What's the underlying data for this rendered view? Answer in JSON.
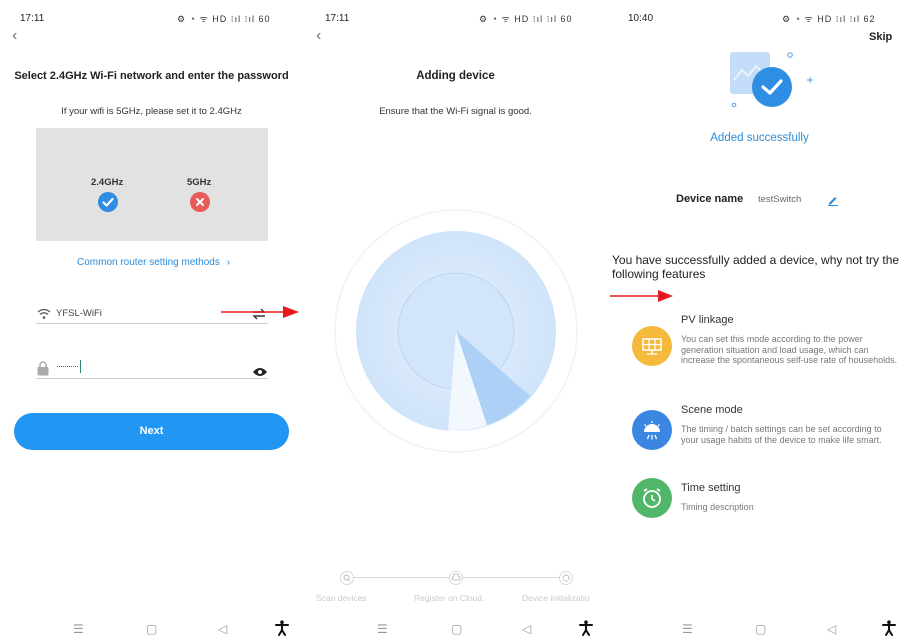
{
  "colors": {
    "accent": "#2196F3",
    "link": "#2b8cd8",
    "success": "#2f8de4",
    "error": "#e95a5a",
    "arrow": "#e31b1b"
  },
  "screen1": {
    "time": "17:11",
    "status_icons": "⚙ ◔ ᯤ HD ⁝ıl ⁝ıl 60",
    "back": "‹",
    "title": "Select 2.4GHz Wi-Fi network and enter the password",
    "subtitle": "If your wifi is 5GHz, please set it to 2.4GHz",
    "band_24": "2.4GHz",
    "band_5": "5GHz",
    "router_link": "Common router setting methods",
    "router_chevron": "›",
    "wifi_name": "YFSL-WiFi",
    "password": "···········",
    "next": "Next"
  },
  "screen2": {
    "time": "17:11",
    "status_icons": "⚙ ◔ ᯤ HD ⁝ıl ⁝ıl 60",
    "back": "‹",
    "title": "Adding device",
    "subtitle": "Ensure that the Wi-Fi signal is good.",
    "steps": [
      "Scan devices",
      "Register on Cloud.",
      "Device initializatio"
    ]
  },
  "screen3": {
    "time": "10:40",
    "status_icons": "⚙ ◔ ᯤ HD ⁝ıl ⁝ıl 62",
    "skip": "Skip",
    "success_text": "Added successfully",
    "device_name_label": "Device name",
    "device_name_value": "testSwitch",
    "promo": "You have successfully added a device, why not try the following features",
    "features": [
      {
        "title": "PV linkage",
        "desc": "You can set this mode according to the power generation situation and load usage, which can increase the spontaneous self-use rate of households.",
        "icon": "solar-panel-icon",
        "color": "#f5b93b"
      },
      {
        "title": "Scene mode",
        "desc": "The timing / batch settings can be set according to your usage habits of the device to make life smart.",
        "icon": "lamp-icon",
        "color": "#3a86e0"
      },
      {
        "title": "Time setting",
        "desc": "Timing description",
        "icon": "alarm-clock-icon",
        "color": "#52b66a"
      }
    ]
  },
  "navbar": {
    "menu": "☰",
    "home": "▢",
    "back": "◁",
    "accessibility": "🕴"
  }
}
